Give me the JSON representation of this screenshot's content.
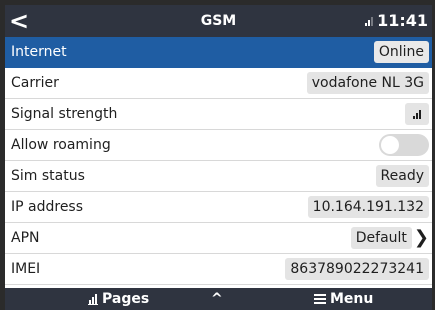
{
  "header": {
    "back_glyph": "<",
    "title": "GSM",
    "time": "11:41"
  },
  "rows": {
    "internet": {
      "label": "Internet",
      "value": "Online"
    },
    "carrier": {
      "label": "Carrier",
      "value": "vodafone NL 3G"
    },
    "signal": {
      "label": "Signal strength"
    },
    "roaming": {
      "label": "Allow roaming",
      "enabled": false
    },
    "sim": {
      "label": "Sim status",
      "value": "Ready"
    },
    "ip": {
      "label": "IP address",
      "value": "10.164.191.132"
    },
    "apn": {
      "label": "APN",
      "value": "Default"
    },
    "imei": {
      "label": "IMEI",
      "value": "863789022273241"
    }
  },
  "footer": {
    "pages_label": "Pages",
    "up_glyph": "^",
    "menu_label": "Menu"
  },
  "colors": {
    "bar": "#2f3440",
    "selected": "#1f5da3"
  }
}
